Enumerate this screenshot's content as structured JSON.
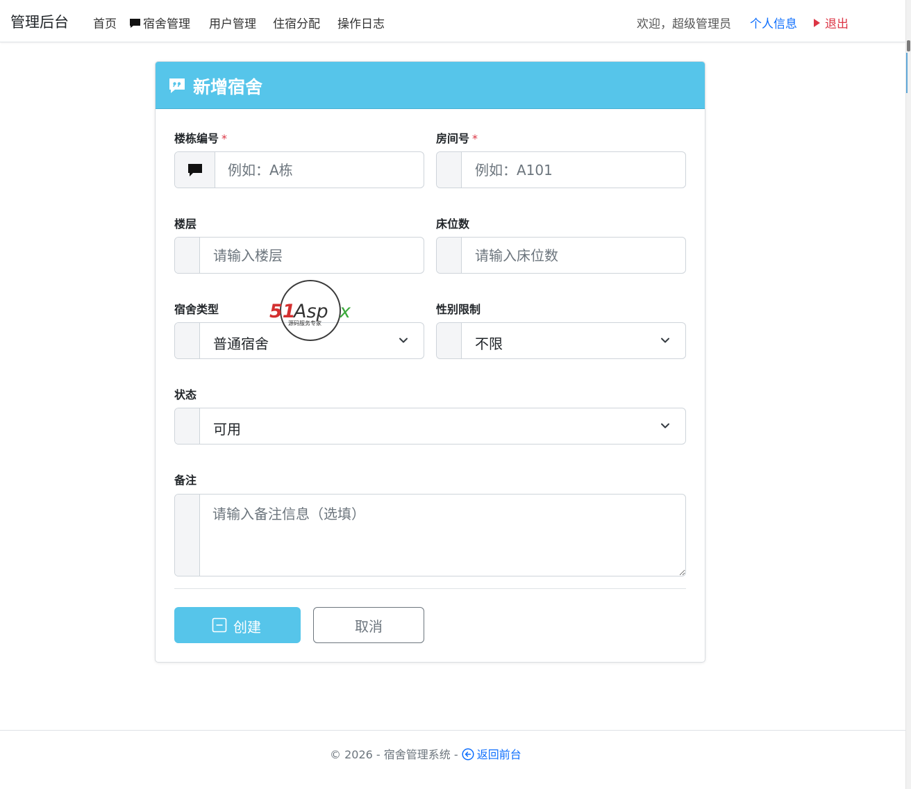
{
  "navbar": {
    "brand": "管理后台",
    "links": [
      {
        "label": "首页"
      },
      {
        "label": "宿舍管理",
        "icon": "chat-bubble-icon"
      },
      {
        "label": "用户管理"
      },
      {
        "label": "住宿分配"
      },
      {
        "label": "操作日志"
      }
    ],
    "welcome": "欢迎，超级管理员",
    "profile": "个人信息",
    "logout": "退出"
  },
  "form": {
    "title": "新增宿舍",
    "building": {
      "label": "楼栋编号",
      "required_mark": "*",
      "placeholder": "例如：A栋"
    },
    "room": {
      "label": "房间号",
      "required_mark": "*",
      "placeholder": "例如：A101"
    },
    "floor": {
      "label": "楼层",
      "placeholder": "请输入楼层"
    },
    "beds": {
      "label": "床位数",
      "placeholder": "请输入床位数"
    },
    "type": {
      "label": "宿舍类型",
      "value": "普通宿舍"
    },
    "gender": {
      "label": "性别限制",
      "value": "不限"
    },
    "status": {
      "label": "状态",
      "value": "可用"
    },
    "remark": {
      "label": "备注",
      "placeholder": "请输入备注信息（选填）"
    },
    "create_button": "创建",
    "cancel_button": "取消"
  },
  "watermark": {
    "text": "51Aspx",
    "sub": "源码服务专家"
  },
  "footer": {
    "text": "© 2026 - 宿舍管理系统 - ",
    "link": "返回前台"
  },
  "colors": {
    "accent": "#56c5ea",
    "link": "#0d6efd",
    "danger": "#dc3545"
  }
}
